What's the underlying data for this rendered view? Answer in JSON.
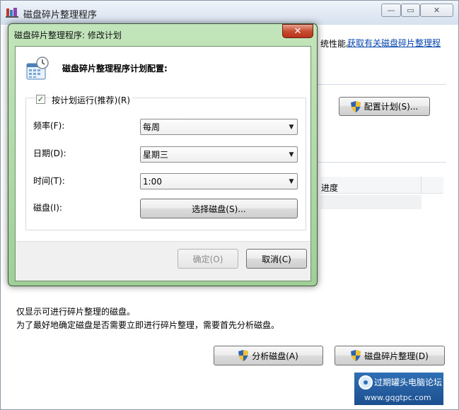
{
  "main_window": {
    "title": "磁盘碎片整理程序",
    "caption_minimize": "—",
    "caption_maximize": "▭",
    "caption_close": "✕",
    "description_fragment": "统性能。",
    "help_link": "获取有关磁盘碎片整理程",
    "configure_schedule_button": "配置计划(S)...",
    "progress_column_header": "进度",
    "note_line1": "仅显示可进行碎片整理的磁盘。",
    "note_line2": "为了最好地确定磁盘是否需要立即进行碎片整理，需要首先分析磁盘。",
    "analyze_button": "分析磁盘(A)",
    "defragment_button": "磁盘碎片整理(D)"
  },
  "dialog": {
    "title": "磁盘碎片整理程序: 修改计划",
    "close": "✕",
    "heading": "磁盘碎片整理程序计划配置:",
    "run_on_schedule_label": "按计划运行(推荐)(R)",
    "run_on_schedule_checked": true,
    "check_glyph": "✓",
    "frequency": {
      "label": "频率(F):",
      "value": "每周"
    },
    "day": {
      "label": "日期(D):",
      "value": "星期三"
    },
    "time": {
      "label": "时间(T):",
      "value": "1:00"
    },
    "disks": {
      "label": "磁盘(I):",
      "button": "选择磁盘(S)..."
    },
    "dropdown_arrow": "▼",
    "ok_button": "确定(O)",
    "cancel_button": "取消(C)"
  },
  "watermark": {
    "text": "过期罐头电脑论坛",
    "url": "www.gqgtpc.com"
  },
  "colors": {
    "link": "#0645ad",
    "dialog_frame": "#a8d59f",
    "close_button": "#c74e32"
  }
}
